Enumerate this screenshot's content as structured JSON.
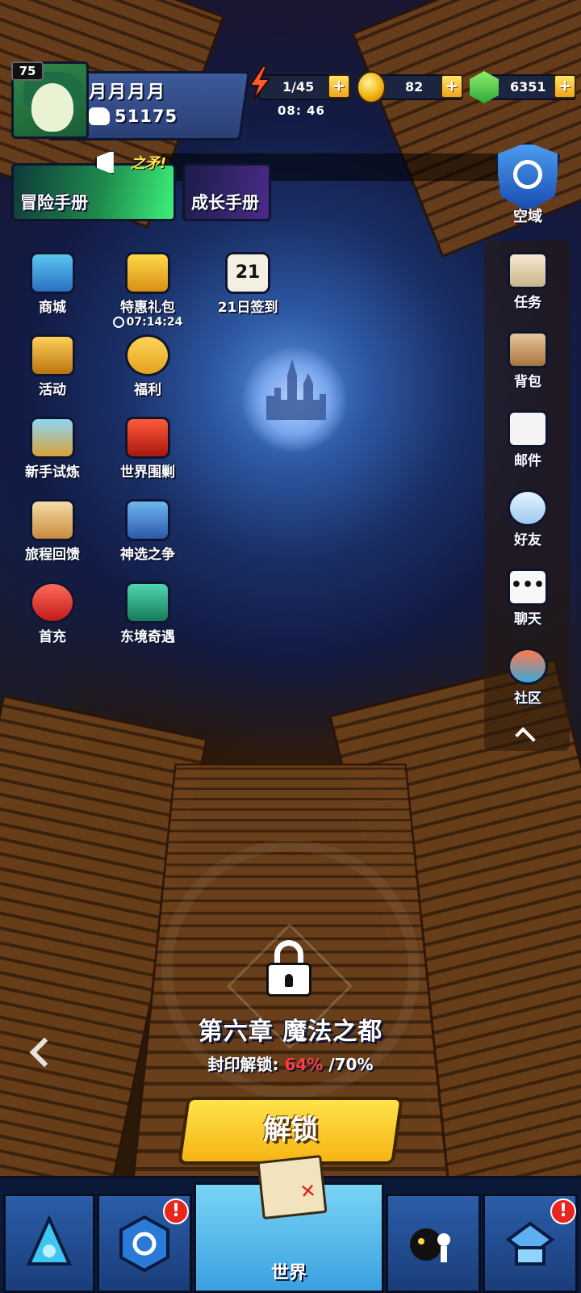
{
  "player": {
    "level": "75",
    "name": "月月月月",
    "power": "51175"
  },
  "resources": {
    "energy": "1/45",
    "energy_timer": "08: 46",
    "coins": "82",
    "gems": "6351",
    "plus_label": "+"
  },
  "manuals": {
    "tagline": "之矛!",
    "adventure": "冒险手册",
    "growth": "成长手册"
  },
  "space": {
    "label": "空域"
  },
  "left_menu": [
    {
      "label": "商城",
      "icon": "shop-chest-icon"
    },
    {
      "label": "特惠礼包",
      "icon": "gift-pack-icon",
      "timer": "07:14:24"
    },
    {
      "label": "21日签到",
      "icon": "calendar-icon",
      "calendar_day": "21"
    },
    {
      "label": "活动",
      "icon": "event-chest-icon"
    },
    {
      "label": "福利",
      "icon": "piggy-bank-icon"
    },
    {
      "label": "新手试炼",
      "icon": "trial-shield-icon"
    },
    {
      "label": "世界围剿",
      "icon": "dragon-icon"
    },
    {
      "label": "旅程回馈",
      "icon": "clipboard-icon"
    },
    {
      "label": "神选之争",
      "icon": "crossed-swords-icon"
    },
    {
      "label": "首充",
      "icon": "first-recharge-icon"
    },
    {
      "label": "东境奇遇",
      "icon": "pagoda-icon"
    }
  ],
  "sidebar": [
    {
      "label": "任务",
      "icon": "scroll-icon"
    },
    {
      "label": "背包",
      "icon": "backpack-icon"
    },
    {
      "label": "邮件",
      "icon": "mail-icon"
    },
    {
      "label": "好友",
      "icon": "friends-icon"
    },
    {
      "label": "聊天",
      "icon": "chat-bubble-icon"
    },
    {
      "label": "社区",
      "icon": "community-icon"
    }
  ],
  "chapter": {
    "title": "第六章 魔法之都",
    "seal_label": "封印解锁:",
    "seal_current": "64%",
    "seal_target": "/70%",
    "unlock_button": "解锁"
  },
  "bottom_nav": {
    "world_label": "世界",
    "alert_mark": "!"
  },
  "colors": {
    "accent_yellow": "#f6b515",
    "alert_red": "#e8261e",
    "progress_red": "#ff3b3b",
    "panel_blue": "#2a3f75"
  }
}
